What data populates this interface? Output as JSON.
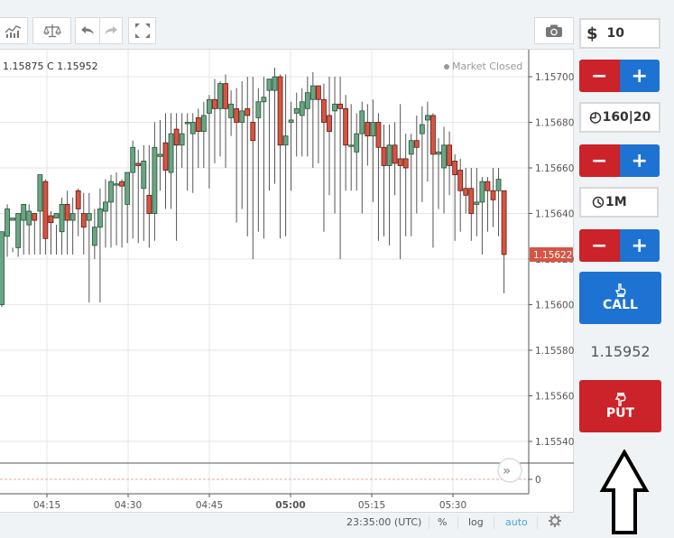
{
  "toolbar": {
    "buttons": [
      {
        "name": "indicators-button",
        "icon": "indicators-icon",
        "glyph": "📈"
      },
      {
        "name": "compare-button",
        "icon": "scales-icon",
        "glyph": "⚖"
      },
      {
        "name": "undo-button",
        "icon": "undo-icon",
        "glyph": "↶"
      },
      {
        "name": "redo-button",
        "icon": "redo-icon",
        "glyph": "↷"
      },
      {
        "name": "fullscreen-button",
        "icon": "fullscreen-icon",
        "glyph": "⛶"
      },
      {
        "name": "screenshot-button",
        "icon": "camera-icon",
        "glyph": "📷"
      }
    ]
  },
  "chart": {
    "ohlc_text": "1.15875 C 1.15952",
    "market_status": "Market Closed",
    "current_price_label": "1.15622",
    "volume_axis_label": "0",
    "scroll_button_glyph": "»",
    "colors": {
      "up": "#6ba583",
      "down": "#d75442",
      "up_border": "#225437",
      "down_border": "#5b1a13",
      "price_tag": "#d75442"
    }
  },
  "bottombar": {
    "time": "23:35:00 (UTC)",
    "percent": "%",
    "log": "log",
    "auto": "auto",
    "settings_icon": "gear-icon"
  },
  "panel": {
    "amount_symbol": "$",
    "amount_value": "10",
    "minus_label": "−",
    "plus_label": "+",
    "payout": "160|20",
    "timeframe": "1M",
    "call_label": "CALL",
    "put_label": "PUT",
    "quote": "1.15952",
    "colors": {
      "call": "#1e73d2",
      "put": "#cc2229"
    }
  },
  "chart_data": {
    "type": "candlestick",
    "title": "",
    "y_ticks": [
      "1.15700",
      "1.15680",
      "1.15660",
      "1.15640",
      "1.15620",
      "1.15600",
      "1.15580",
      "1.15560",
      "1.15540"
    ],
    "x_ticks": [
      {
        "label": "04:15",
        "bold": false
      },
      {
        "label": "04:30",
        "bold": false
      },
      {
        "label": "04:45",
        "bold": false
      },
      {
        "label": "05:00",
        "bold": true
      },
      {
        "label": "05:15",
        "bold": false
      },
      {
        "label": "05:30",
        "bold": false
      }
    ],
    "ylim": [
      1.15532,
      1.15712
    ],
    "last_price": 1.15622,
    "candles": [
      [
        1.156,
        1.15632,
        1.15599,
        1.1563
      ],
      [
        1.1563,
        1.15642,
        1.15621,
        1.15644
      ],
      [
        1.15637,
        1.15638,
        1.15623,
        1.15625
      ],
      [
        1.15625,
        1.1564,
        1.15621,
        1.15635
      ],
      [
        1.15637,
        1.15644,
        1.15622,
        1.15641
      ],
      [
        1.15635,
        1.15641,
        1.15622,
        1.15644
      ],
      [
        1.1564,
        1.15637,
        1.15622,
        1.1564
      ],
      [
        1.15641,
        1.15657,
        1.15622,
        1.15655
      ],
      [
        1.15654,
        1.15629,
        1.15622,
        1.15655
      ],
      [
        1.15639,
        1.15636,
        1.15622,
        1.15641
      ],
      [
        1.15638,
        1.1564,
        1.15622,
        1.15635
      ],
      [
        1.15632,
        1.15644,
        1.15622,
        1.15647
      ],
      [
        1.15644,
        1.15637,
        1.15622,
        1.1565
      ],
      [
        1.15637,
        1.1564,
        1.15622,
        1.15647
      ],
      [
        1.1565,
        1.15642,
        1.1563,
        1.15651
      ],
      [
        1.1564,
        1.15634,
        1.15622,
        1.15649
      ],
      [
        1.15637,
        1.1564,
        1.15601,
        1.15649
      ],
      [
        1.15626,
        1.15634,
        1.1562,
        1.15642
      ],
      [
        1.15634,
        1.15642,
        1.15601,
        1.15651
      ],
      [
        1.15641,
        1.15645,
        1.15625,
        1.15655
      ],
      [
        1.15645,
        1.15654,
        1.15625,
        1.15657
      ],
      [
        1.15653,
        1.15653,
        1.15626,
        1.15658
      ],
      [
        1.15654,
        1.15652,
        1.15625,
        1.15655
      ],
      [
        1.15644,
        1.15658,
        1.15627,
        1.15658
      ],
      [
        1.15658,
        1.15669,
        1.15629,
        1.15672
      ],
      [
        1.15662,
        1.15661,
        1.15627,
        1.15668
      ],
      [
        1.15651,
        1.15663,
        1.15628,
        1.1567
      ],
      [
        1.15648,
        1.1564,
        1.15625,
        1.1567
      ],
      [
        1.1564,
        1.15669,
        1.15628,
        1.1568
      ],
      [
        1.15665,
        1.15666,
        1.1565,
        1.15681
      ],
      [
        1.15671,
        1.15659,
        1.15642,
        1.15684
      ],
      [
        1.15658,
        1.15675,
        1.15642,
        1.15684
      ],
      [
        1.15677,
        1.1567,
        1.15628,
        1.15684
      ],
      [
        1.1567,
        1.15675,
        1.1566,
        1.15684
      ],
      [
        1.1568,
        1.1568,
        1.1565,
        1.15684
      ],
      [
        1.15675,
        1.1568,
        1.15649,
        1.15684
      ],
      [
        1.15682,
        1.15676,
        1.1566,
        1.15686
      ],
      [
        1.15676,
        1.15683,
        1.1566,
        1.15689
      ],
      [
        1.15684,
        1.1569,
        1.15651,
        1.15692
      ],
      [
        1.1569,
        1.15686,
        1.15662,
        1.15699
      ],
      [
        1.15686,
        1.15697,
        1.15665,
        1.15698
      ],
      [
        1.15697,
        1.15686,
        1.1566,
        1.15701
      ],
      [
        1.15682,
        1.15688,
        1.15674,
        1.15694
      ],
      [
        1.15686,
        1.1568,
        1.15636,
        1.15695
      ],
      [
        1.1568,
        1.15685,
        1.15642,
        1.15698
      ],
      [
        1.15686,
        1.15683,
        1.1563,
        1.157
      ],
      [
        1.1568,
        1.15672,
        1.1562,
        1.157
      ],
      [
        1.15682,
        1.15689,
        1.15632,
        1.15695
      ],
      [
        1.15689,
        1.15691,
        1.15629,
        1.157
      ],
      [
        1.15694,
        1.15699,
        1.1565,
        1.15699
      ],
      [
        1.15694,
        1.157,
        1.15653,
        1.15704
      ],
      [
        1.157,
        1.1567,
        1.15629,
        1.15701
      ],
      [
        1.1567,
        1.15674,
        1.1563,
        1.15701
      ],
      [
        1.1568,
        1.15681,
        1.1565,
        1.15689
      ],
      [
        1.15684,
        1.15686,
        1.15665,
        1.15693
      ],
      [
        1.15683,
        1.15689,
        1.15665,
        1.15695
      ],
      [
        1.15686,
        1.15693,
        1.15665,
        1.157
      ],
      [
        1.1569,
        1.15696,
        1.1566,
        1.15702
      ],
      [
        1.15696,
        1.1569,
        1.15662,
        1.15696
      ],
      [
        1.1569,
        1.1568,
        1.15632,
        1.15697
      ],
      [
        1.15683,
        1.15676,
        1.15648,
        1.157
      ],
      [
        1.15685,
        1.15688,
        1.1564,
        1.157
      ],
      [
        1.15688,
        1.15686,
        1.1562,
        1.157
      ],
      [
        1.15686,
        1.1567,
        1.1565,
        1.15692
      ],
      [
        1.1567,
        1.1567,
        1.1565,
        1.15688
      ],
      [
        1.15667,
        1.15675,
        1.1565,
        1.15684
      ],
      [
        1.15675,
        1.15685,
        1.1564,
        1.15689
      ],
      [
        1.1568,
        1.15674,
        1.15661,
        1.15688
      ],
      [
        1.15674,
        1.1568,
        1.15645,
        1.1569
      ],
      [
        1.1568,
        1.15669,
        1.15628,
        1.15684
      ],
      [
        1.15669,
        1.15661,
        1.1563,
        1.15679
      ],
      [
        1.15661,
        1.1567,
        1.15626,
        1.15679
      ],
      [
        1.1567,
        1.15662,
        1.15648,
        1.1568
      ],
      [
        1.15664,
        1.15661,
        1.1562,
        1.15688
      ],
      [
        1.15664,
        1.1566,
        1.1563,
        1.15675
      ],
      [
        1.15666,
        1.15672,
        1.1563,
        1.15675
      ],
      [
        1.15672,
        1.15669,
        1.1564,
        1.15683
      ],
      [
        1.15675,
        1.15679,
        1.15645,
        1.15687
      ],
      [
        1.15681,
        1.15683,
        1.15654,
        1.15689
      ],
      [
        1.15683,
        1.15666,
        1.15625,
        1.15684
      ],
      [
        1.15666,
        1.15667,
        1.15642,
        1.15673
      ],
      [
        1.1566,
        1.1567,
        1.1564,
        1.15678
      ],
      [
        1.1567,
        1.15661,
        1.15648,
        1.15676
      ],
      [
        1.15663,
        1.15657,
        1.15628,
        1.15666
      ],
      [
        1.15659,
        1.1565,
        1.15632,
        1.15664
      ],
      [
        1.15651,
        1.15648,
        1.1564,
        1.1566
      ],
      [
        1.15651,
        1.1564,
        1.15628,
        1.1566
      ],
      [
        1.15644,
        1.15645,
        1.1563,
        1.1566
      ],
      [
        1.15645,
        1.15654,
        1.15622,
        1.15656
      ],
      [
        1.15654,
        1.1565,
        1.15632,
        1.15656
      ],
      [
        1.1565,
        1.15646,
        1.15634,
        1.1566
      ],
      [
        1.1565,
        1.15655,
        1.1563,
        1.1566
      ],
      [
        1.1565,
        1.15622,
        1.15605,
        1.1565
      ]
    ]
  }
}
